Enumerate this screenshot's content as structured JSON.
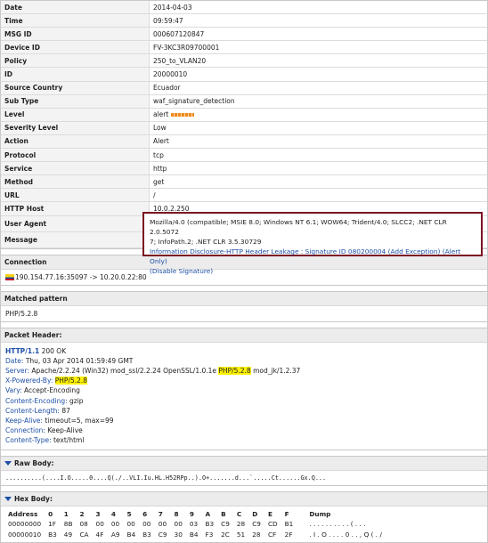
{
  "fields": [
    {
      "key": "Date",
      "value": "2014-04-03"
    },
    {
      "key": "Time",
      "value": "09:59:47"
    },
    {
      "key": "MSG ID",
      "value": "000607120847"
    },
    {
      "key": "Device ID",
      "value": "FV-3KC3R09700001"
    },
    {
      "key": "Policy",
      "value": "250_to_VLAN20"
    },
    {
      "key": "ID",
      "value": "20000010"
    },
    {
      "key": "Source Country",
      "value": "Ecuador"
    },
    {
      "key": "Sub Type",
      "value": "waf_signature_detection"
    },
    {
      "key": "Level",
      "value": "alert"
    },
    {
      "key": "Severity Level",
      "value": "Low"
    },
    {
      "key": "Action",
      "value": "Alert"
    },
    {
      "key": "Protocol",
      "value": "tcp"
    },
    {
      "key": "Service",
      "value": "http"
    },
    {
      "key": "Method",
      "value": "get"
    },
    {
      "key": "URL",
      "value": "/"
    },
    {
      "key": "HTTP Host",
      "value": "10.0.2.250"
    },
    {
      "key": "User Agent",
      "value": ""
    },
    {
      "key": "Message",
      "value": ""
    }
  ],
  "highlight_box": {
    "user_agent_line1": "Mozilla/4.0 (compatible; MSIE 8.0; Windows NT 6.1; WOW64; Trident/4.0; SLCC2; .NET CLR 2.0.5072",
    "user_agent_line2": "7; InfoPath.2; .NET CLR 3.5.30729",
    "message_line1": "Information Disclosure-HTTP Header Leakage : Signature ID 080200004 (Add Exception) (Alert Only)",
    "message_line2": "(Disable Signature)"
  },
  "connection": {
    "title": "Connection",
    "value": "190.154.77.16:35097 -> 10.20.0.22:80"
  },
  "matched_pattern": {
    "title": "Matched pattern",
    "value": "PHP/5.2.8"
  },
  "packet_header": {
    "title": "Packet Header:",
    "status_proto": "HTTP/1.1",
    "status_code": " 200 OK",
    "lines": [
      {
        "k": "Date:",
        "pre": " Thu, 03 Apr 2014 01:59:49 GMT",
        "hl": "",
        "post": ""
      },
      {
        "k": "Server:",
        "pre": " Apache/2.2.24 (Win32) mod_ssl/2.2.24 OpenSSL/1.0.1e ",
        "hl": "PHP/5.2.8",
        "post": " mod_jk/1.2.37"
      },
      {
        "k": "X-Powered-By:",
        "pre": " ",
        "hl": "PHP/5.2.8",
        "post": ""
      },
      {
        "k": "Vary:",
        "pre": " Accept-Encoding",
        "hl": "",
        "post": ""
      },
      {
        "k": "Content-Encoding:",
        "pre": " gzip",
        "hl": "",
        "post": ""
      },
      {
        "k": "Content-Length:",
        "pre": " 87",
        "hl": "",
        "post": ""
      },
      {
        "k": "Keep-Alive:",
        "pre": " timeout=5, max=99",
        "hl": "",
        "post": ""
      },
      {
        "k": "Connection:",
        "pre": " Keep-Alive",
        "hl": "",
        "post": ""
      },
      {
        "k": "Content-Type:",
        "pre": " text/html",
        "hl": "",
        "post": ""
      }
    ]
  },
  "raw_body": {
    "title": "Raw Body:",
    "value": "..........(....I.O.....0....Q(./..VLI.Iu.HL.H52RPp..).O+.......d...`.....Ct......Gx.Q..."
  },
  "hex_body": {
    "title": "Hex Body:",
    "headers": [
      "Address",
      "0",
      "1",
      "2",
      "3",
      "4",
      "5",
      "6",
      "7",
      "8",
      "9",
      "A",
      "B",
      "C",
      "D",
      "E",
      "F",
      "Dump"
    ],
    "rows": [
      [
        "00000000",
        "1F",
        "8B",
        "08",
        "00",
        "00",
        "00",
        "00",
        "00",
        "00",
        "03",
        "B3",
        "C9",
        "28",
        "C9",
        "CD",
        "B1",
        ". . . . . . . . . . ( . . ."
      ],
      [
        "00000010",
        "B3",
        "49",
        "CA",
        "4F",
        "A9",
        "B4",
        "B3",
        "C9",
        "30",
        "B4",
        "F3",
        "2C",
        "51",
        "28",
        "CF",
        "2F",
        ". I . O . . . . 0 . . , Q ( . /"
      ]
    ]
  },
  "colors": {
    "highlight_border": "#7a1020",
    "link": "#1d4fa6",
    "highlight_text": "#fff200"
  }
}
